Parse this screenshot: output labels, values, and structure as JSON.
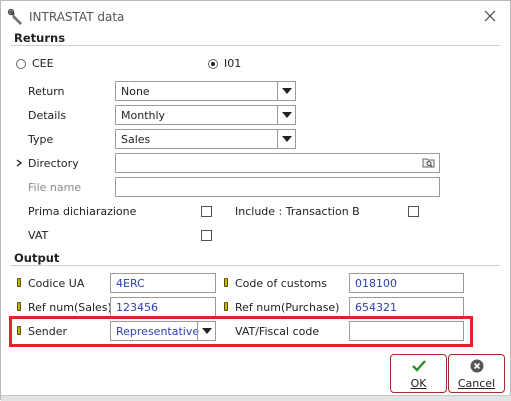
{
  "window": {
    "title": "INTRASTAT data"
  },
  "returns": {
    "section_label": "Returns",
    "radio_cee": "CEE",
    "radio_i01": "I01",
    "selected_radio": "I01",
    "return_label": "Return",
    "return_value": "None",
    "details_label": "Details",
    "details_value": "Monthly",
    "type_label": "Type",
    "type_value": "Sales",
    "directory_label": "Directory",
    "directory_value": "",
    "filename_label": "File name",
    "filename_value": "",
    "prima_label": "Prima dichiarazione",
    "include_label": "Include : Transaction B",
    "vat_label": "VAT"
  },
  "output": {
    "section_label": "Output",
    "codice_ua_label": "Codice UA",
    "codice_ua_value": "4ERC",
    "code_customs_label": "Code of customs",
    "code_customs_value": "018100",
    "ref_sales_label": "Ref num(Sales)",
    "ref_sales_value": "123456",
    "ref_purchase_label": "Ref num(Purchase)",
    "ref_purchase_value": "654321",
    "sender_label": "Sender",
    "sender_value": "Representative",
    "vat_fiscal_label": "VAT/Fiscal code",
    "vat_fiscal_value": ""
  },
  "buttons": {
    "ok_label": "OK",
    "cancel_label": "Cancel"
  },
  "colors": {
    "highlight_frame": "#e0232b",
    "value_text": "#2b3fb2",
    "button_border": "#a52a2a",
    "ok_icon": "#2e8b2e",
    "marker": "#c8b100"
  },
  "icons": {
    "title": "wrench-icon",
    "close": "close-icon",
    "browse": "folder-search-icon",
    "ok": "checkmark-icon",
    "cancel": "cancel-circle-icon",
    "required": "required-marker-icon"
  }
}
